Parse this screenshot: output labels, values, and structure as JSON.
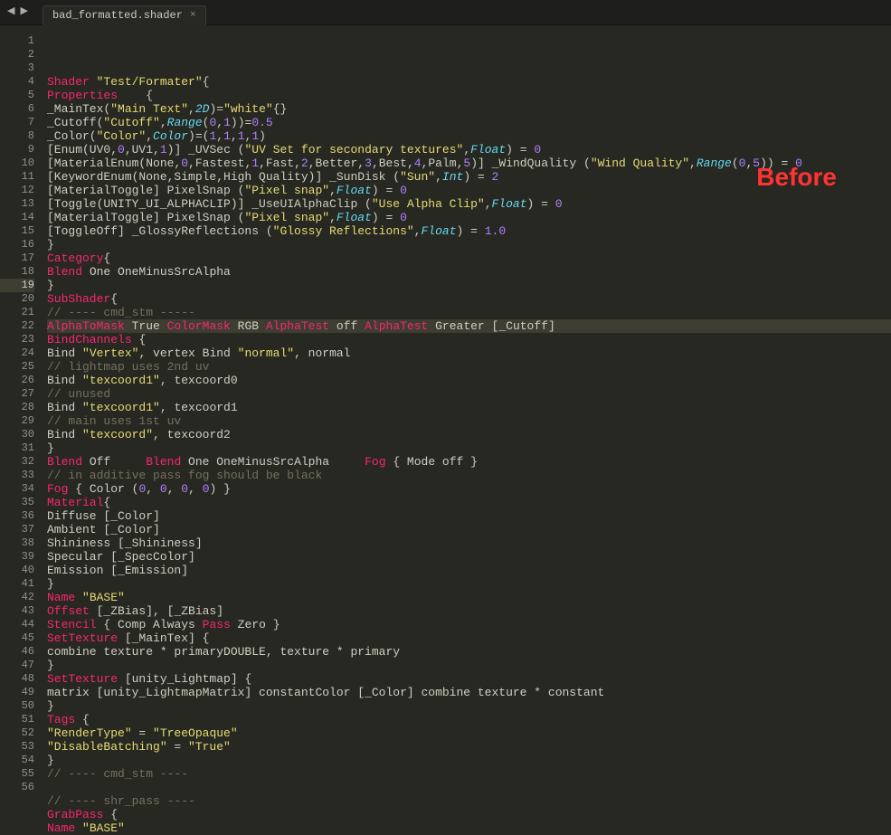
{
  "tab": {
    "name": "bad_formatted.shader",
    "close": "×"
  },
  "nav": {
    "back": "◀",
    "fwd": "▶"
  },
  "label": "Before",
  "highlightLine": 19,
  "lines": [
    {
      "n": 1,
      "t": [
        [
          "kw",
          "Shader"
        ],
        [
          "txt",
          " "
        ],
        [
          "str",
          "\"Test/Formater\""
        ],
        [
          "brace",
          "{"
        ]
      ]
    },
    {
      "n": 2,
      "t": [
        [
          "kw",
          "Properties"
        ],
        [
          "txt",
          "    "
        ],
        [
          "brace",
          "{"
        ]
      ]
    },
    {
      "n": 3,
      "t": [
        [
          "txt",
          "_MainTex("
        ],
        [
          "str",
          "\"Main Text\""
        ],
        [
          "txt",
          ","
        ],
        [
          "typ",
          "2D"
        ],
        [
          "txt",
          ")="
        ],
        [
          "str",
          "\"white\""
        ],
        [
          "brace",
          "{}"
        ]
      ]
    },
    {
      "n": 4,
      "t": [
        [
          "txt",
          "_Cutoff("
        ],
        [
          "str",
          "\"Cutoff\""
        ],
        [
          "txt",
          ","
        ],
        [
          "typ",
          "Range"
        ],
        [
          "txt",
          "("
        ],
        [
          "num",
          "0"
        ],
        [
          "txt",
          ","
        ],
        [
          "num",
          "1"
        ],
        [
          "txt",
          "))="
        ],
        [
          "num",
          "0.5"
        ]
      ]
    },
    {
      "n": 5,
      "t": [
        [
          "txt",
          "_Color("
        ],
        [
          "str",
          "\"Color\""
        ],
        [
          "txt",
          ","
        ],
        [
          "typ",
          "Color"
        ],
        [
          "txt",
          ")=("
        ],
        [
          "num",
          "1"
        ],
        [
          "txt",
          ","
        ],
        [
          "num",
          "1"
        ],
        [
          "txt",
          ","
        ],
        [
          "num",
          "1"
        ],
        [
          "txt",
          ","
        ],
        [
          "num",
          "1"
        ],
        [
          "txt",
          ")"
        ]
      ]
    },
    {
      "n": 6,
      "t": [
        [
          "txt",
          "[Enum(UV0,"
        ],
        [
          "num",
          "0"
        ],
        [
          "txt",
          ",UV1,"
        ],
        [
          "num",
          "1"
        ],
        [
          "txt",
          ")] _UVSec ("
        ],
        [
          "str",
          "\"UV Set for secondary textures\""
        ],
        [
          "txt",
          ","
        ],
        [
          "typ",
          "Float"
        ],
        [
          "txt",
          ") = "
        ],
        [
          "num",
          "0"
        ]
      ]
    },
    {
      "n": 7,
      "t": [
        [
          "txt",
          "[MaterialEnum(None,"
        ],
        [
          "num",
          "0"
        ],
        [
          "txt",
          ",Fastest,"
        ],
        [
          "num",
          "1"
        ],
        [
          "txt",
          ",Fast,"
        ],
        [
          "num",
          "2"
        ],
        [
          "txt",
          ",Better,"
        ],
        [
          "num",
          "3"
        ],
        [
          "txt",
          ",Best,"
        ],
        [
          "num",
          "4"
        ],
        [
          "txt",
          ",Palm,"
        ],
        [
          "num",
          "5"
        ],
        [
          "txt",
          ")] _WindQuality ("
        ],
        [
          "str",
          "\"Wind Quality\""
        ],
        [
          "txt",
          ","
        ],
        [
          "typ",
          "Range"
        ],
        [
          "txt",
          "("
        ],
        [
          "num",
          "0"
        ],
        [
          "txt",
          ","
        ],
        [
          "num",
          "5"
        ],
        [
          "txt",
          ")) = "
        ],
        [
          "num",
          "0"
        ]
      ]
    },
    {
      "n": 8,
      "t": [
        [
          "txt",
          "[KeywordEnum(None,Simple,High Quality)] _SunDisk ("
        ],
        [
          "str",
          "\"Sun\""
        ],
        [
          "txt",
          ","
        ],
        [
          "typ",
          "Int"
        ],
        [
          "txt",
          ") = "
        ],
        [
          "num",
          "2"
        ]
      ]
    },
    {
      "n": 9,
      "t": [
        [
          "txt",
          "[MaterialToggle] PixelSnap ("
        ],
        [
          "str",
          "\"Pixel snap\""
        ],
        [
          "txt",
          ","
        ],
        [
          "typ",
          "Float"
        ],
        [
          "txt",
          ") = "
        ],
        [
          "num",
          "0"
        ]
      ]
    },
    {
      "n": 10,
      "t": [
        [
          "txt",
          "[Toggle(UNITY_UI_ALPHACLIP)] _UseUIAlphaClip ("
        ],
        [
          "str",
          "\"Use Alpha Clip\""
        ],
        [
          "txt",
          ","
        ],
        [
          "typ",
          "Float"
        ],
        [
          "txt",
          ") = "
        ],
        [
          "num",
          "0"
        ]
      ]
    },
    {
      "n": 11,
      "t": [
        [
          "txt",
          "[MaterialToggle] PixelSnap ("
        ],
        [
          "str",
          "\"Pixel snap\""
        ],
        [
          "txt",
          ","
        ],
        [
          "typ",
          "Float"
        ],
        [
          "txt",
          ") = "
        ],
        [
          "num",
          "0"
        ]
      ]
    },
    {
      "n": 12,
      "t": [
        [
          "txt",
          "[ToggleOff] _GlossyReflections ("
        ],
        [
          "str",
          "\"Glossy Reflections\""
        ],
        [
          "txt",
          ","
        ],
        [
          "typ",
          "Float"
        ],
        [
          "txt",
          ") = "
        ],
        [
          "num",
          "1.0"
        ]
      ]
    },
    {
      "n": 13,
      "t": [
        [
          "brace",
          "}"
        ]
      ]
    },
    {
      "n": 14,
      "t": [
        [
          "kw",
          "Category"
        ],
        [
          "brace",
          "{"
        ]
      ]
    },
    {
      "n": 15,
      "t": [
        [
          "kw",
          "Blend"
        ],
        [
          "txt",
          " One OneMinusSrcAlpha"
        ]
      ]
    },
    {
      "n": 16,
      "t": [
        [
          "brace",
          "}"
        ]
      ]
    },
    {
      "n": 17,
      "t": [
        [
          "kw",
          "SubShader"
        ],
        [
          "brace",
          "{"
        ]
      ]
    },
    {
      "n": 18,
      "t": [
        [
          "com",
          "// ---- cmd_stm -----"
        ]
      ]
    },
    {
      "n": 19,
      "t": [
        [
          "kw",
          "AlphaToMask"
        ],
        [
          "txt",
          " True "
        ],
        [
          "kw",
          "ColorMask"
        ],
        [
          "txt",
          " RGB "
        ],
        [
          "kw",
          "AlphaTest"
        ],
        [
          "txt",
          " off "
        ],
        [
          "kw",
          "AlphaTest"
        ],
        [
          "txt",
          " Greater [_Cutoff]"
        ]
      ]
    },
    {
      "n": 20,
      "t": [
        [
          "kw",
          "BindChannels"
        ],
        [
          "txt",
          " "
        ],
        [
          "brace",
          "{"
        ]
      ]
    },
    {
      "n": 21,
      "t": [
        [
          "txt",
          "Bind "
        ],
        [
          "str",
          "\"Vertex\""
        ],
        [
          "txt",
          ", vertex Bind "
        ],
        [
          "str",
          "\"normal\""
        ],
        [
          "txt",
          ", normal"
        ]
      ]
    },
    {
      "n": 22,
      "t": [
        [
          "com",
          "// lightmap uses 2nd uv"
        ]
      ]
    },
    {
      "n": 23,
      "t": [
        [
          "txt",
          "Bind "
        ],
        [
          "str",
          "\"texcoord1\""
        ],
        [
          "txt",
          ", texcoord0"
        ]
      ]
    },
    {
      "n": 24,
      "t": [
        [
          "com",
          "// unused"
        ]
      ]
    },
    {
      "n": 25,
      "t": [
        [
          "txt",
          "Bind "
        ],
        [
          "str",
          "\"texcoord1\""
        ],
        [
          "txt",
          ", texcoord1"
        ]
      ]
    },
    {
      "n": 26,
      "t": [
        [
          "com",
          "// main uses 1st uv"
        ]
      ]
    },
    {
      "n": 27,
      "t": [
        [
          "txt",
          "Bind "
        ],
        [
          "str",
          "\"texcoord\""
        ],
        [
          "txt",
          ", texcoord2"
        ]
      ]
    },
    {
      "n": 28,
      "t": [
        [
          "brace",
          "}"
        ]
      ]
    },
    {
      "n": 29,
      "t": [
        [
          "kw",
          "Blend"
        ],
        [
          "txt",
          " Off     "
        ],
        [
          "kw",
          "Blend"
        ],
        [
          "txt",
          " One OneMinusSrcAlpha     "
        ],
        [
          "kw",
          "Fog"
        ],
        [
          "txt",
          " "
        ],
        [
          "brace",
          "{"
        ],
        [
          "txt",
          " Mode off "
        ],
        [
          "brace",
          "}"
        ]
      ]
    },
    {
      "n": 30,
      "t": [
        [
          "com",
          "// in additive pass fog should be black"
        ]
      ]
    },
    {
      "n": 31,
      "t": [
        [
          "kw",
          "Fog"
        ],
        [
          "txt",
          " "
        ],
        [
          "brace",
          "{"
        ],
        [
          "txt",
          " Color ("
        ],
        [
          "num",
          "0"
        ],
        [
          "txt",
          ", "
        ],
        [
          "num",
          "0"
        ],
        [
          "txt",
          ", "
        ],
        [
          "num",
          "0"
        ],
        [
          "txt",
          ", "
        ],
        [
          "num",
          "0"
        ],
        [
          "txt",
          ") "
        ],
        [
          "brace",
          "}"
        ]
      ]
    },
    {
      "n": 32,
      "t": [
        [
          "kw",
          "Material"
        ],
        [
          "brace",
          "{"
        ]
      ]
    },
    {
      "n": 33,
      "t": [
        [
          "txt",
          "Diffuse [_Color]"
        ]
      ]
    },
    {
      "n": 34,
      "t": [
        [
          "txt",
          "Ambient [_Color]"
        ]
      ]
    },
    {
      "n": 35,
      "t": [
        [
          "txt",
          "Shininess [_Shininess]"
        ]
      ]
    },
    {
      "n": 36,
      "t": [
        [
          "txt",
          "Specular [_SpecColor]"
        ]
      ]
    },
    {
      "n": 37,
      "t": [
        [
          "txt",
          "Emission [_Emission]"
        ]
      ]
    },
    {
      "n": 38,
      "t": [
        [
          "brace",
          "}"
        ]
      ]
    },
    {
      "n": 39,
      "t": [
        [
          "kw",
          "Name"
        ],
        [
          "txt",
          " "
        ],
        [
          "str",
          "\"BASE\""
        ]
      ]
    },
    {
      "n": 40,
      "t": [
        [
          "kw",
          "Offset"
        ],
        [
          "txt",
          " [_ZBias], [_ZBias]"
        ]
      ]
    },
    {
      "n": 41,
      "t": [
        [
          "kw",
          "Stencil"
        ],
        [
          "txt",
          " "
        ],
        [
          "brace",
          "{"
        ],
        [
          "txt",
          " Comp Always "
        ],
        [
          "kw",
          "Pass"
        ],
        [
          "txt",
          " Zero "
        ],
        [
          "brace",
          "}"
        ]
      ]
    },
    {
      "n": 42,
      "t": [
        [
          "kw",
          "SetTexture"
        ],
        [
          "txt",
          " [_MainTex] "
        ],
        [
          "brace",
          "{"
        ]
      ]
    },
    {
      "n": 43,
      "t": [
        [
          "txt",
          "combine texture * primaryDOUBLE, texture * primary"
        ]
      ]
    },
    {
      "n": 44,
      "t": [
        [
          "brace",
          "}"
        ]
      ]
    },
    {
      "n": 45,
      "t": [
        [
          "kw",
          "SetTexture"
        ],
        [
          "txt",
          " [unity_Lightmap] "
        ],
        [
          "brace",
          "{"
        ]
      ]
    },
    {
      "n": 46,
      "t": [
        [
          "txt",
          "matrix [unity_LightmapMatrix] constantColor [_Color] combine texture * constant"
        ]
      ]
    },
    {
      "n": 47,
      "t": [
        [
          "brace",
          "}"
        ]
      ]
    },
    {
      "n": 48,
      "t": [
        [
          "kw",
          "Tags"
        ],
        [
          "txt",
          " "
        ],
        [
          "brace",
          "{"
        ]
      ]
    },
    {
      "n": 49,
      "t": [
        [
          "str",
          "\"RenderType\""
        ],
        [
          "txt",
          " = "
        ],
        [
          "str",
          "\"TreeOpaque\""
        ]
      ]
    },
    {
      "n": 50,
      "t": [
        [
          "str",
          "\"DisableBatching\""
        ],
        [
          "txt",
          " = "
        ],
        [
          "str",
          "\"True\""
        ]
      ]
    },
    {
      "n": 51,
      "t": [
        [
          "brace",
          "}"
        ]
      ]
    },
    {
      "n": 52,
      "t": [
        [
          "com",
          "// ---- cmd_stm ----"
        ]
      ]
    },
    {
      "n": 53,
      "t": [
        [
          "txt",
          ""
        ]
      ]
    },
    {
      "n": 54,
      "t": [
        [
          "com",
          "// ---- shr_pass ----"
        ]
      ]
    },
    {
      "n": 55,
      "t": [
        [
          "kw",
          "GrabPass"
        ],
        [
          "txt",
          " "
        ],
        [
          "brace",
          "{"
        ]
      ]
    },
    {
      "n": 56,
      "t": [
        [
          "kw",
          "Name"
        ],
        [
          "txt",
          " "
        ],
        [
          "str",
          "\"BASE\""
        ]
      ]
    }
  ]
}
